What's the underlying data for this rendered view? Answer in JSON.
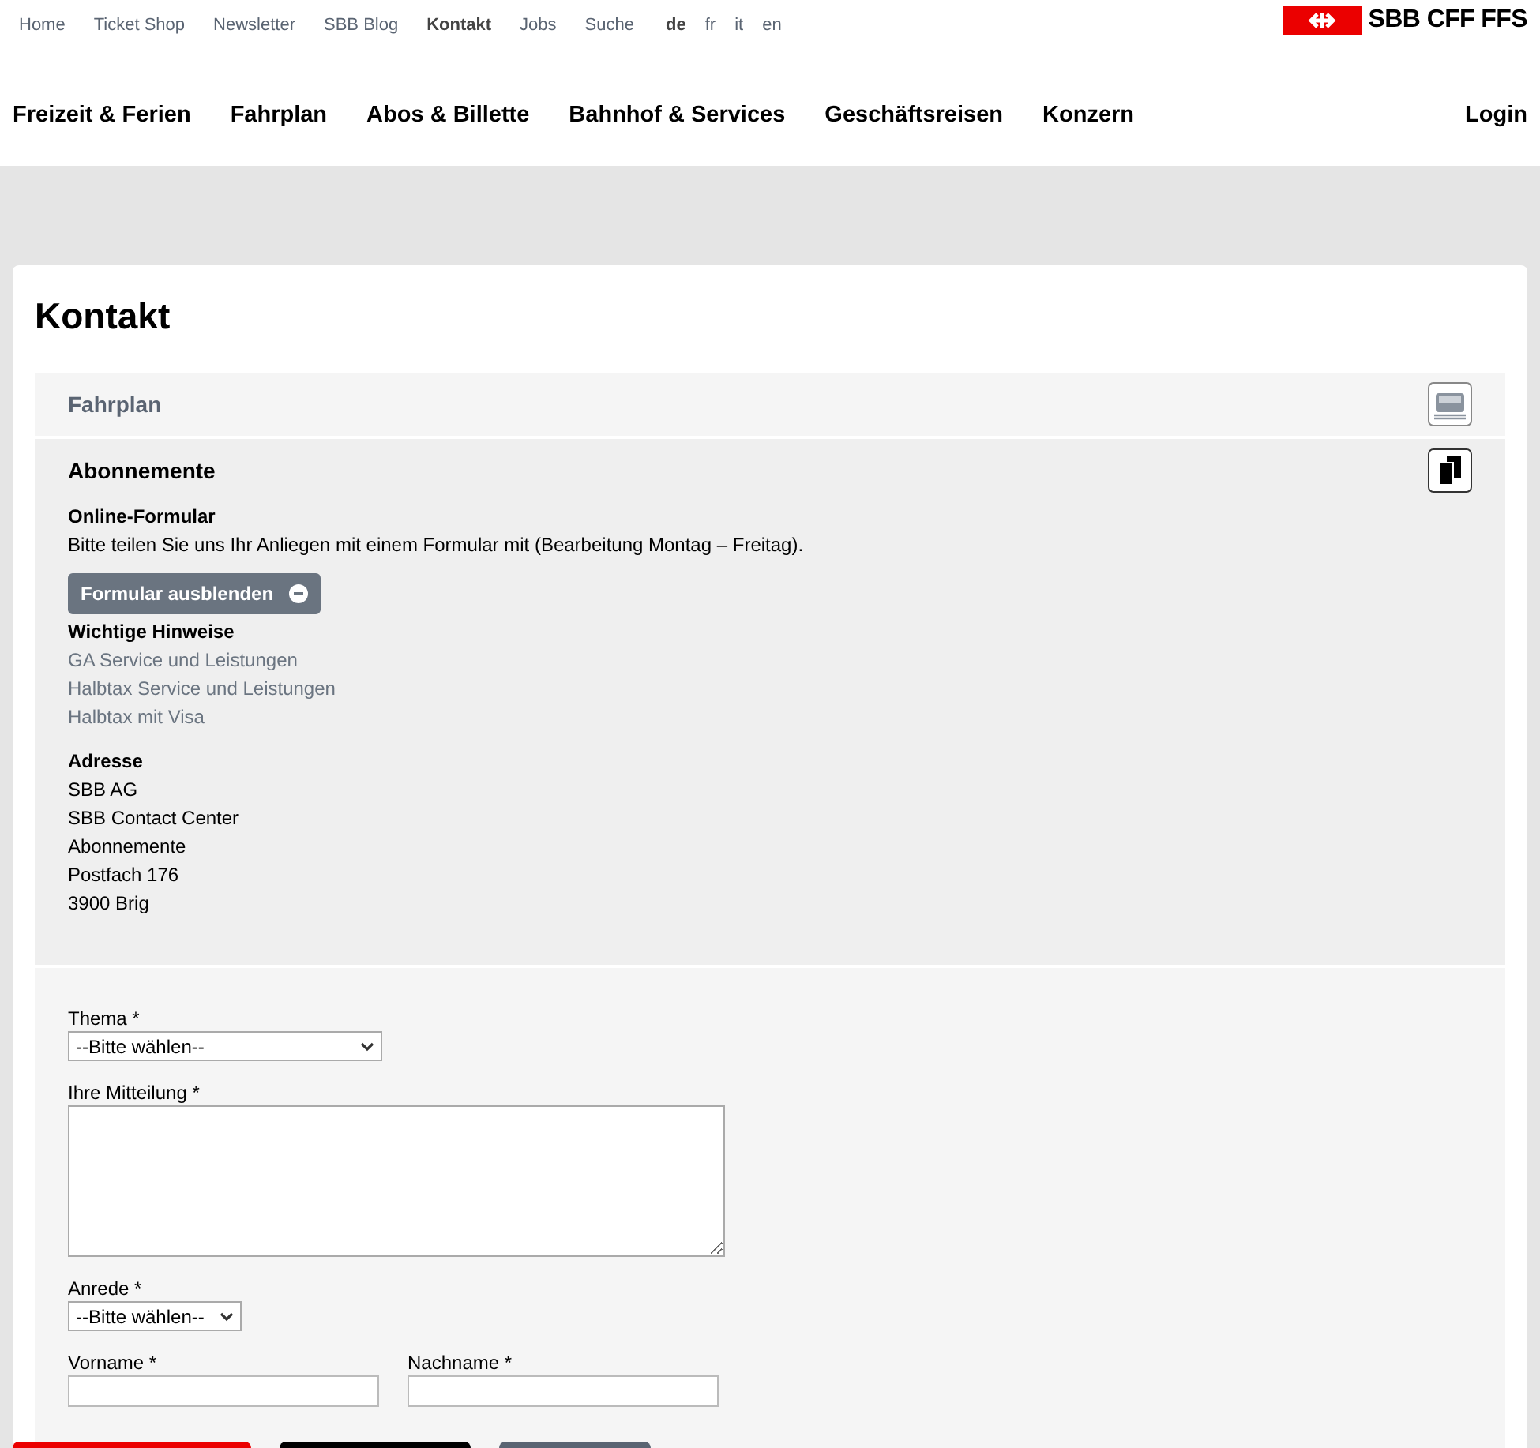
{
  "top_links": [
    {
      "label": "Home",
      "selected": false
    },
    {
      "label": "Ticket Shop",
      "selected": false
    },
    {
      "label": "Newsletter",
      "selected": false
    },
    {
      "label": "SBB Blog",
      "selected": false
    },
    {
      "label": "Kontakt",
      "selected": true
    },
    {
      "label": "Jobs",
      "selected": false
    },
    {
      "label": "Suche",
      "selected": false
    }
  ],
  "languages": [
    {
      "label": "de",
      "selected": true
    },
    {
      "label": "fr",
      "selected": false
    },
    {
      "label": "it",
      "selected": false
    },
    {
      "label": "en",
      "selected": false
    }
  ],
  "logo": {
    "text": "SBB CFF FFS"
  },
  "main_nav": [
    "Freizeit & Ferien",
    "Fahrplan",
    "Abos & Billette",
    "Bahnhof & Services",
    "Geschäftsreisen",
    "Konzern"
  ],
  "login": "Login",
  "page_title": "Kontakt",
  "accordion": [
    {
      "title": "Fahrplan",
      "expanded": false
    },
    {
      "title": "Abonnemente",
      "expanded": true,
      "online_heading": "Online-Formular",
      "online_text": "Bitte teilen Sie uns Ihr Anliegen mit einem Formular mit (Bearbeitung Montag – Freitag).",
      "toggle_button": "Formular ausblenden",
      "notes_heading": "Wichtige Hinweise",
      "links": [
        "GA Service und Leistungen",
        "Halbtax Service und Leistungen",
        "Halbtax mit Visa"
      ],
      "address_heading": "Adresse",
      "address_lines": [
        "SBB AG",
        "SBB Contact Center",
        "Abonnemente",
        "Postfach 176",
        "3900 Brig"
      ]
    }
  ],
  "form": {
    "rows": [
      [
        {
          "kind": "select",
          "label": "Thema *",
          "value": "--Bitte wählen--"
        }
      ],
      [
        {
          "kind": "textarea",
          "label": "Ihre Mitteilung *"
        }
      ],
      [
        {
          "kind": "select",
          "label": "Anrede *",
          "value": "--Bitte wählen--"
        }
      ],
      [
        {
          "kind": "text",
          "label": "Vorname *"
        },
        {
          "kind": "text",
          "label": "Nachname *"
        }
      ]
    ]
  },
  "bottom_buttons": [
    {
      "color": "#eb0000"
    },
    {
      "color": "#000000"
    },
    {
      "color": "#5a6472"
    }
  ]
}
